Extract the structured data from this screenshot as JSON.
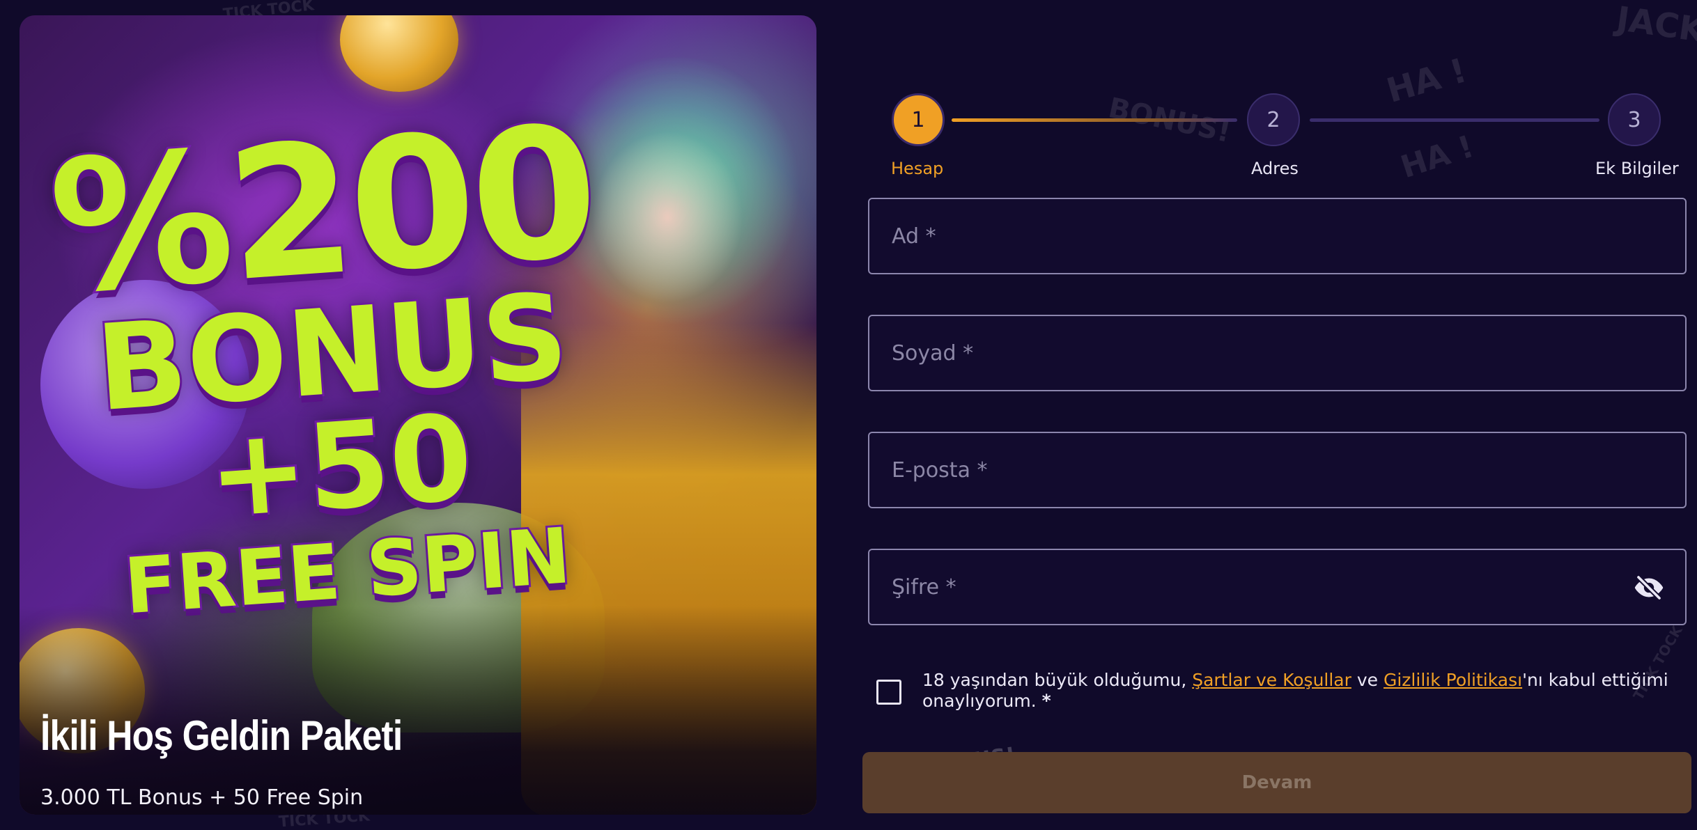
{
  "promo": {
    "headline_line1": "%200",
    "headline_line2": "BONUS",
    "headline_line3": "+50",
    "headline_line4": "FREE SPIN",
    "title": "İkili Hoş Geldin Paketi",
    "subtitle": "3.000 TL Bonus + 50 Free Spin"
  },
  "stepper": {
    "steps": [
      {
        "number": "1",
        "label": "Hesap",
        "state": "active"
      },
      {
        "number": "2",
        "label": "Adres",
        "state": "idle"
      },
      {
        "number": "3",
        "label": "Ek Bilgiler",
        "state": "idle"
      }
    ]
  },
  "form": {
    "first_name_placeholder": "Ad *",
    "last_name_placeholder": "Soyad *",
    "email_placeholder": "E-posta *",
    "password_placeholder": "Şifre *",
    "consent": {
      "text_before": "18 yaşından büyük olduğumu, ",
      "terms_link": "Şartlar ve Koşullar",
      "text_middle": " ve ",
      "privacy_link": "Gizlilik Politikası",
      "text_after": "'nı kabul ettiğimi onaylıyorum. ",
      "required_mark": "*",
      "checked": false
    },
    "submit_label": "Devam"
  },
  "decor": {
    "doodle_1": "TICK TOCK",
    "doodle_2": "JACKP",
    "doodle_3": "BONUS!",
    "doodle_4": "HA !",
    "doodle_5": "HA !",
    "doodle_6": "TICK TOCK",
    "doodle_7": "BONUS!",
    "doodle_8": "TICK TOCK"
  },
  "colors": {
    "background": "#100a2a",
    "accent": "#f0a025",
    "submit_disabled": "#5a3e2c"
  }
}
